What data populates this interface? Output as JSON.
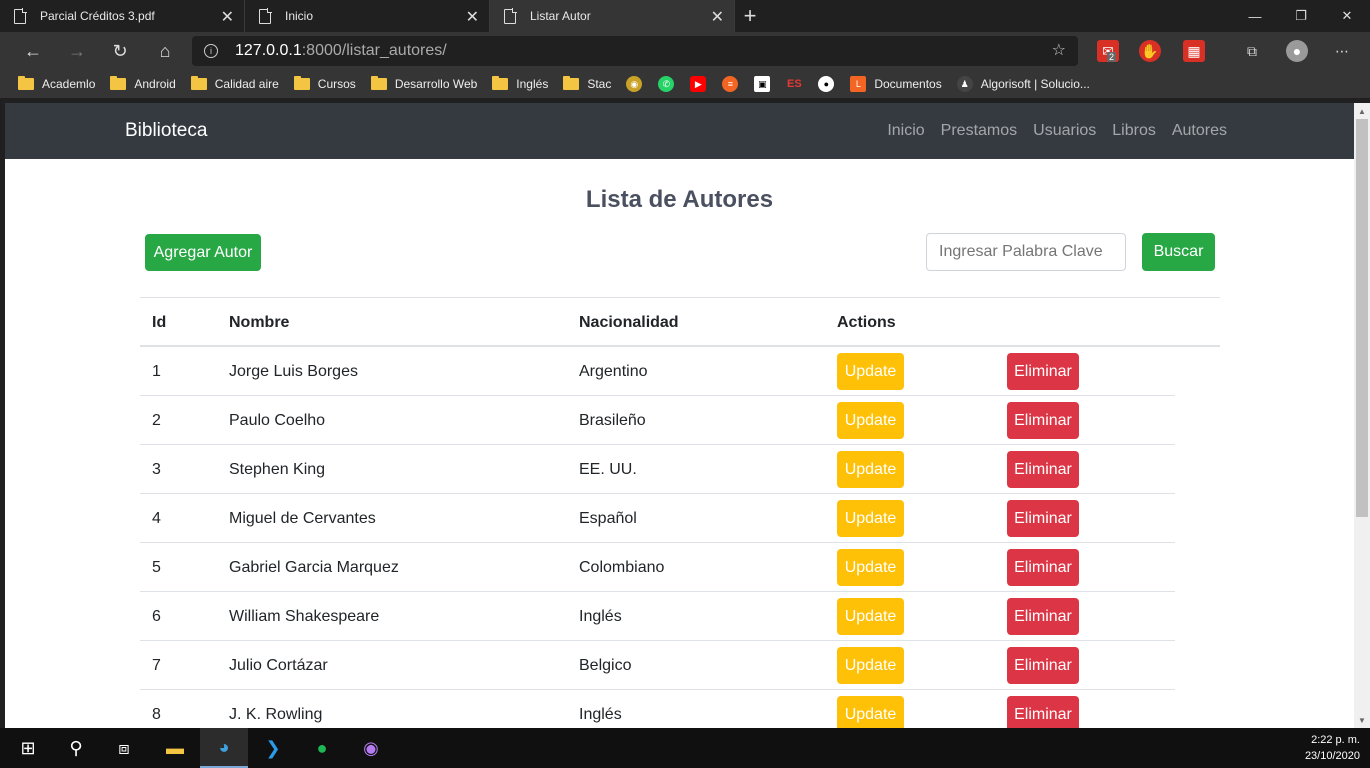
{
  "browser": {
    "tabs": [
      {
        "title": "Parcial Créditos 3.pdf"
      },
      {
        "title": "Inicio"
      },
      {
        "title": "Listar Autor"
      }
    ],
    "url_host": "127.0.0.1",
    "url_rest": ":8000/listar_autores/",
    "ext_badge": "2",
    "bookmarks": [
      {
        "label": "Academlo",
        "icon": "folder-icon"
      },
      {
        "label": "Android",
        "icon": "folder-icon"
      },
      {
        "label": "Calidad aire",
        "icon": "folder-icon"
      },
      {
        "label": "Cursos",
        "icon": "folder-icon"
      },
      {
        "label": "Desarrollo Web",
        "icon": "folder-icon"
      },
      {
        "label": "Inglés",
        "icon": "folder-icon"
      },
      {
        "label": "Stac",
        "icon": "folder-icon"
      },
      {
        "label": "Documentos",
        "icon": "documentos-icon"
      },
      {
        "label": "Algorisoft | Solucio...",
        "icon": "algorisoft-icon"
      }
    ]
  },
  "site": {
    "brand": "Biblioteca",
    "nav": [
      "Inicio",
      "Prestamos",
      "Usuarios",
      "Libros",
      "Autores"
    ],
    "page_title": "Lista de Autores",
    "add_button": "Agregar Autor",
    "search_placeholder": "Ingresar Palabra Clave",
    "search_button": "Buscar",
    "columns": [
      "Id",
      "Nombre",
      "Nacionalidad",
      "Actions"
    ],
    "update_label": "Update",
    "delete_label": "Eliminar",
    "rows": [
      {
        "id": "1",
        "nombre": "Jorge Luis Borges",
        "nacionalidad": "Argentino"
      },
      {
        "id": "2",
        "nombre": "Paulo Coelho",
        "nacionalidad": "Brasileño"
      },
      {
        "id": "3",
        "nombre": "Stephen King",
        "nacionalidad": "EE. UU."
      },
      {
        "id": "4",
        "nombre": "Miguel de Cervantes",
        "nacionalidad": "Español"
      },
      {
        "id": "5",
        "nombre": "Gabriel Garcia Marquez",
        "nacionalidad": "Colombiano"
      },
      {
        "id": "6",
        "nombre": "William Shakespeare",
        "nacionalidad": "Inglés"
      },
      {
        "id": "7",
        "nombre": "Julio Cortázar",
        "nacionalidad": "Belgico"
      },
      {
        "id": "8",
        "nombre": "J. K. Rowling",
        "nacionalidad": "Inglés"
      }
    ]
  },
  "taskbar": {
    "time": "2:22 p. m.",
    "date": "23/10/2020"
  },
  "colors": {
    "navbar": "#343a40",
    "success": "#28a745",
    "warning": "#ffc107",
    "danger": "#dc3545"
  }
}
